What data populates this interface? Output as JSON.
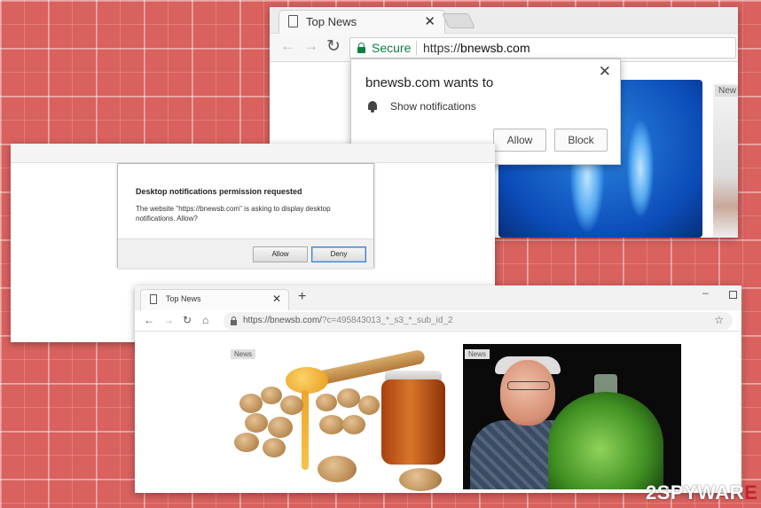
{
  "window1": {
    "tab_title": "Top News",
    "tab_close": "✕",
    "back": "←",
    "forward": "→",
    "reload": "↻",
    "secure_label": "Secure",
    "url_scheme": "https://",
    "url_domain": "bnewsb.com",
    "side_badge": "New",
    "popup": {
      "close": "✕",
      "heading": "bnewsb.com wants to",
      "permission": "Show notifications",
      "allow": "Allow",
      "block": "Block"
    },
    "secure_color": "#0b8043"
  },
  "window2": {
    "dialog_title": "Desktop notifications permission requested",
    "dialog_message": "The website \"https://bnewsb.com\" is asking to display desktop notifications. Allow?",
    "allow": "Allow",
    "deny": "Deny"
  },
  "window3": {
    "tab_title": "Top News",
    "tab_close": "✕",
    "new_tab": "+",
    "minimize": "–",
    "back": "←",
    "forward": "→",
    "reload": "↻",
    "home": "⌂",
    "url_base": "https://bnewsb.com/",
    "url_path": "?c=495843013_*_s3_*_sub_id_2",
    "bookmark": "☆",
    "card1_badge": "News",
    "card2_badge": "News"
  },
  "watermark": {
    "part1": "2SPYWAR",
    "part2": "E"
  }
}
